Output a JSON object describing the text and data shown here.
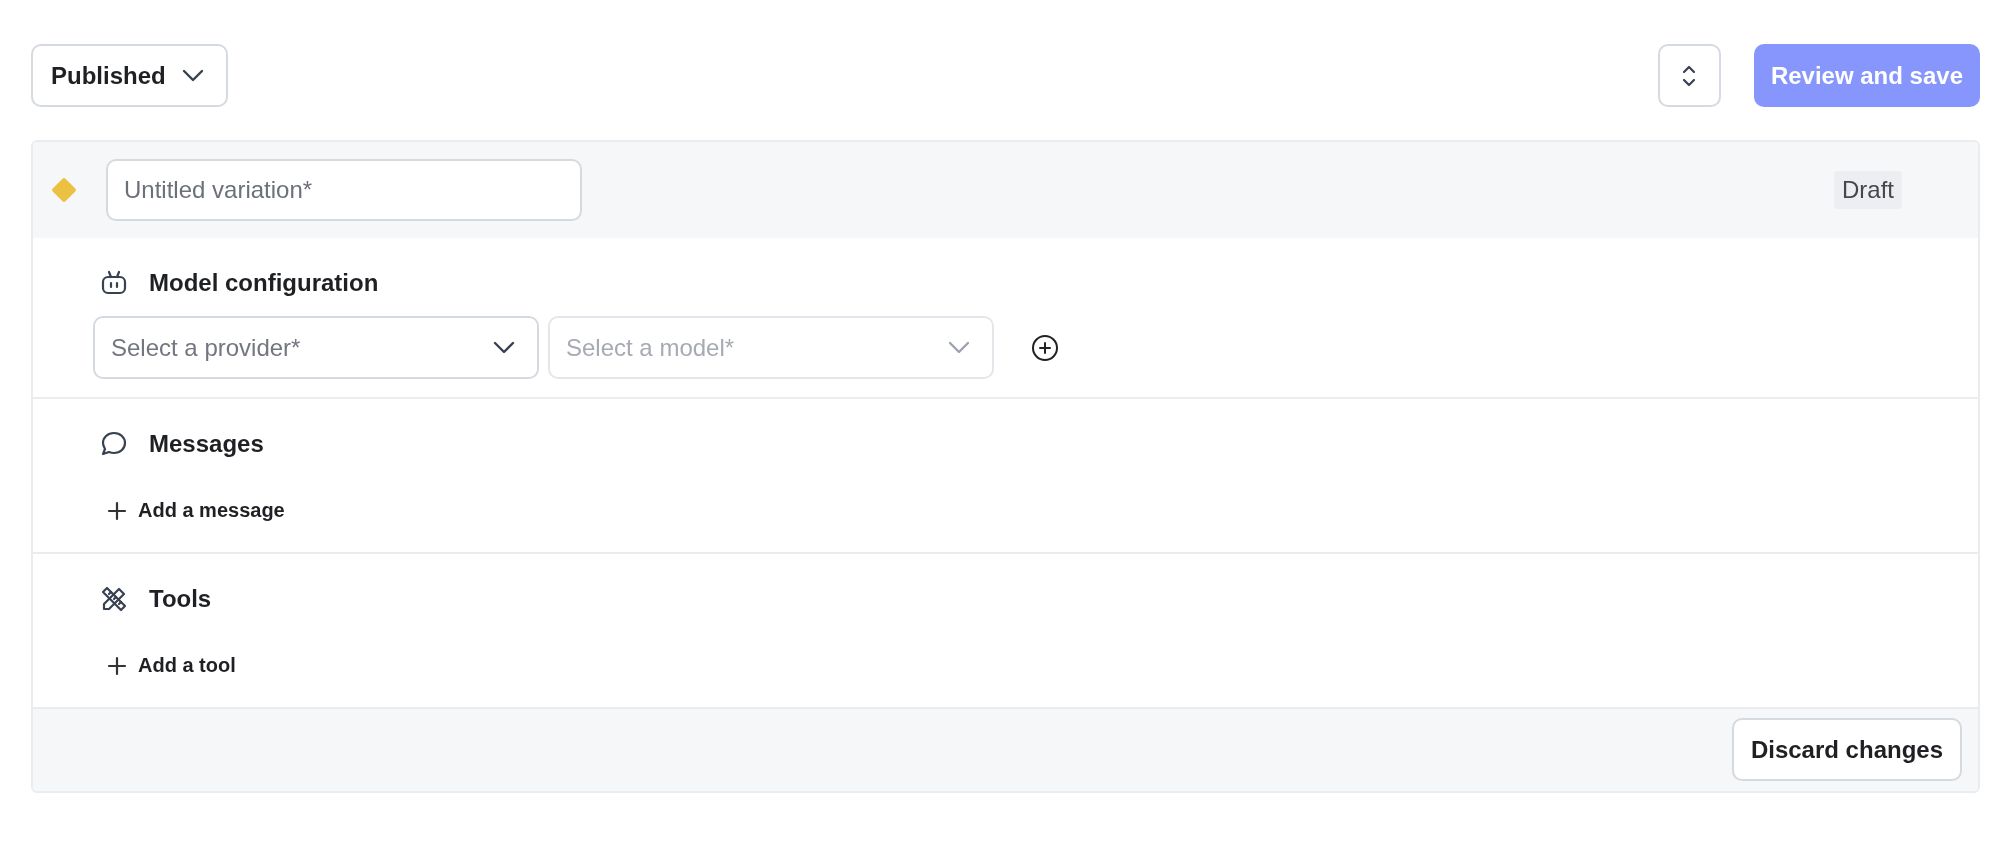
{
  "status_menu": {
    "label": "Published"
  },
  "actions": {
    "review": {
      "label": "Review and save",
      "disabled": true
    }
  },
  "variation": {
    "name_placeholder": "Untitled variation*",
    "status": "Draft"
  },
  "sections": [
    {
      "kind": "model",
      "title": "Model configuration",
      "selects": [
        {
          "placeholder": "Select a provider*",
          "disabled": false
        },
        {
          "placeholder": "Select a model*",
          "disabled": true
        }
      ]
    },
    {
      "kind": "messages",
      "title": "Messages",
      "add_label": "Add a message"
    },
    {
      "kind": "tools",
      "title": "Tools",
      "add_label": "Add a tool"
    }
  ],
  "footer": {
    "discard": "Discard changes"
  }
}
